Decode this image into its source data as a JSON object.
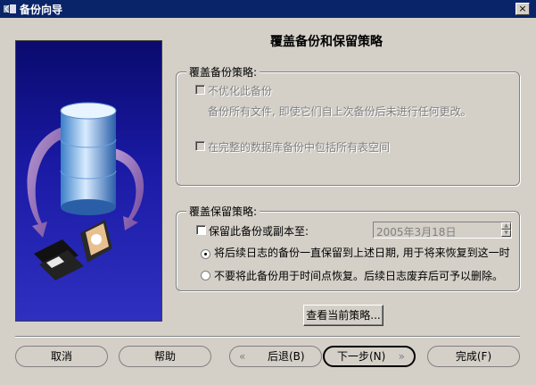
{
  "window": {
    "title": "备份向导",
    "close_glyph": "×"
  },
  "heading": "覆盖备份和保留策略",
  "override_policy": {
    "legend": "覆盖备份策略:",
    "no_optimize_label": "不优化此备份",
    "no_optimize_desc": "备份所有文件, 即使它们自上次备份后未进行任何更改。",
    "include_empty_label": "在完整的数据库备份中包括所有表空间"
  },
  "retention_policy": {
    "legend": "覆盖保留策略:",
    "keep_label": "保留此备份或副本至:",
    "date_value": "2005年3月18日",
    "option_keep_label": "将后续日志的备份一直保留到上述日期, 用于将来恢复到这一时间点",
    "option_no_recover_label": "不要将此备份用于时间点恢复。后续日志废弃后可予以删除。"
  },
  "view_policy_button": "查看当前策略...",
  "footer": {
    "cancel": "取消",
    "help": "帮助",
    "back": "后退(B)",
    "next": "下一步(N)",
    "finish": "完成(F)"
  },
  "icons": {
    "window_icon": "backup-wizard-icon",
    "back_arrow": "double-chevron-left-icon",
    "next_arrow": "double-chevron-right-icon"
  }
}
